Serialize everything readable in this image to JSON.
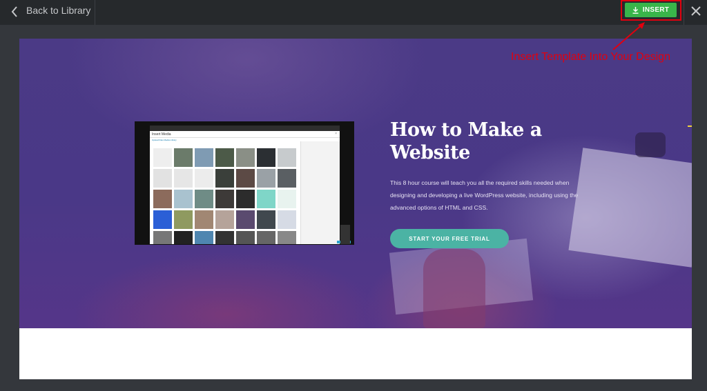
{
  "topbar": {
    "back_label": "Back to Library",
    "insert_label": "INSERT",
    "accent_color": "#39b54a"
  },
  "annotation": {
    "text": "Insert Template Into Your Design",
    "color": "#e1000f"
  },
  "template_preview": {
    "hero": {
      "title_line1": "How to Make a",
      "title_line2": "Website",
      "description": "This 8 hour course will teach you all the required skills needed when designing and developing a live WordPress website, including using the advanced options of HTML and CSS.",
      "cta_label": "START YOUR FREE TRIAL",
      "cta_color": "#4bb3a4"
    },
    "media_modal": {
      "title": "Insert Media",
      "tabs": "Upload Files   Media Library",
      "close_glyph": "×"
    }
  }
}
